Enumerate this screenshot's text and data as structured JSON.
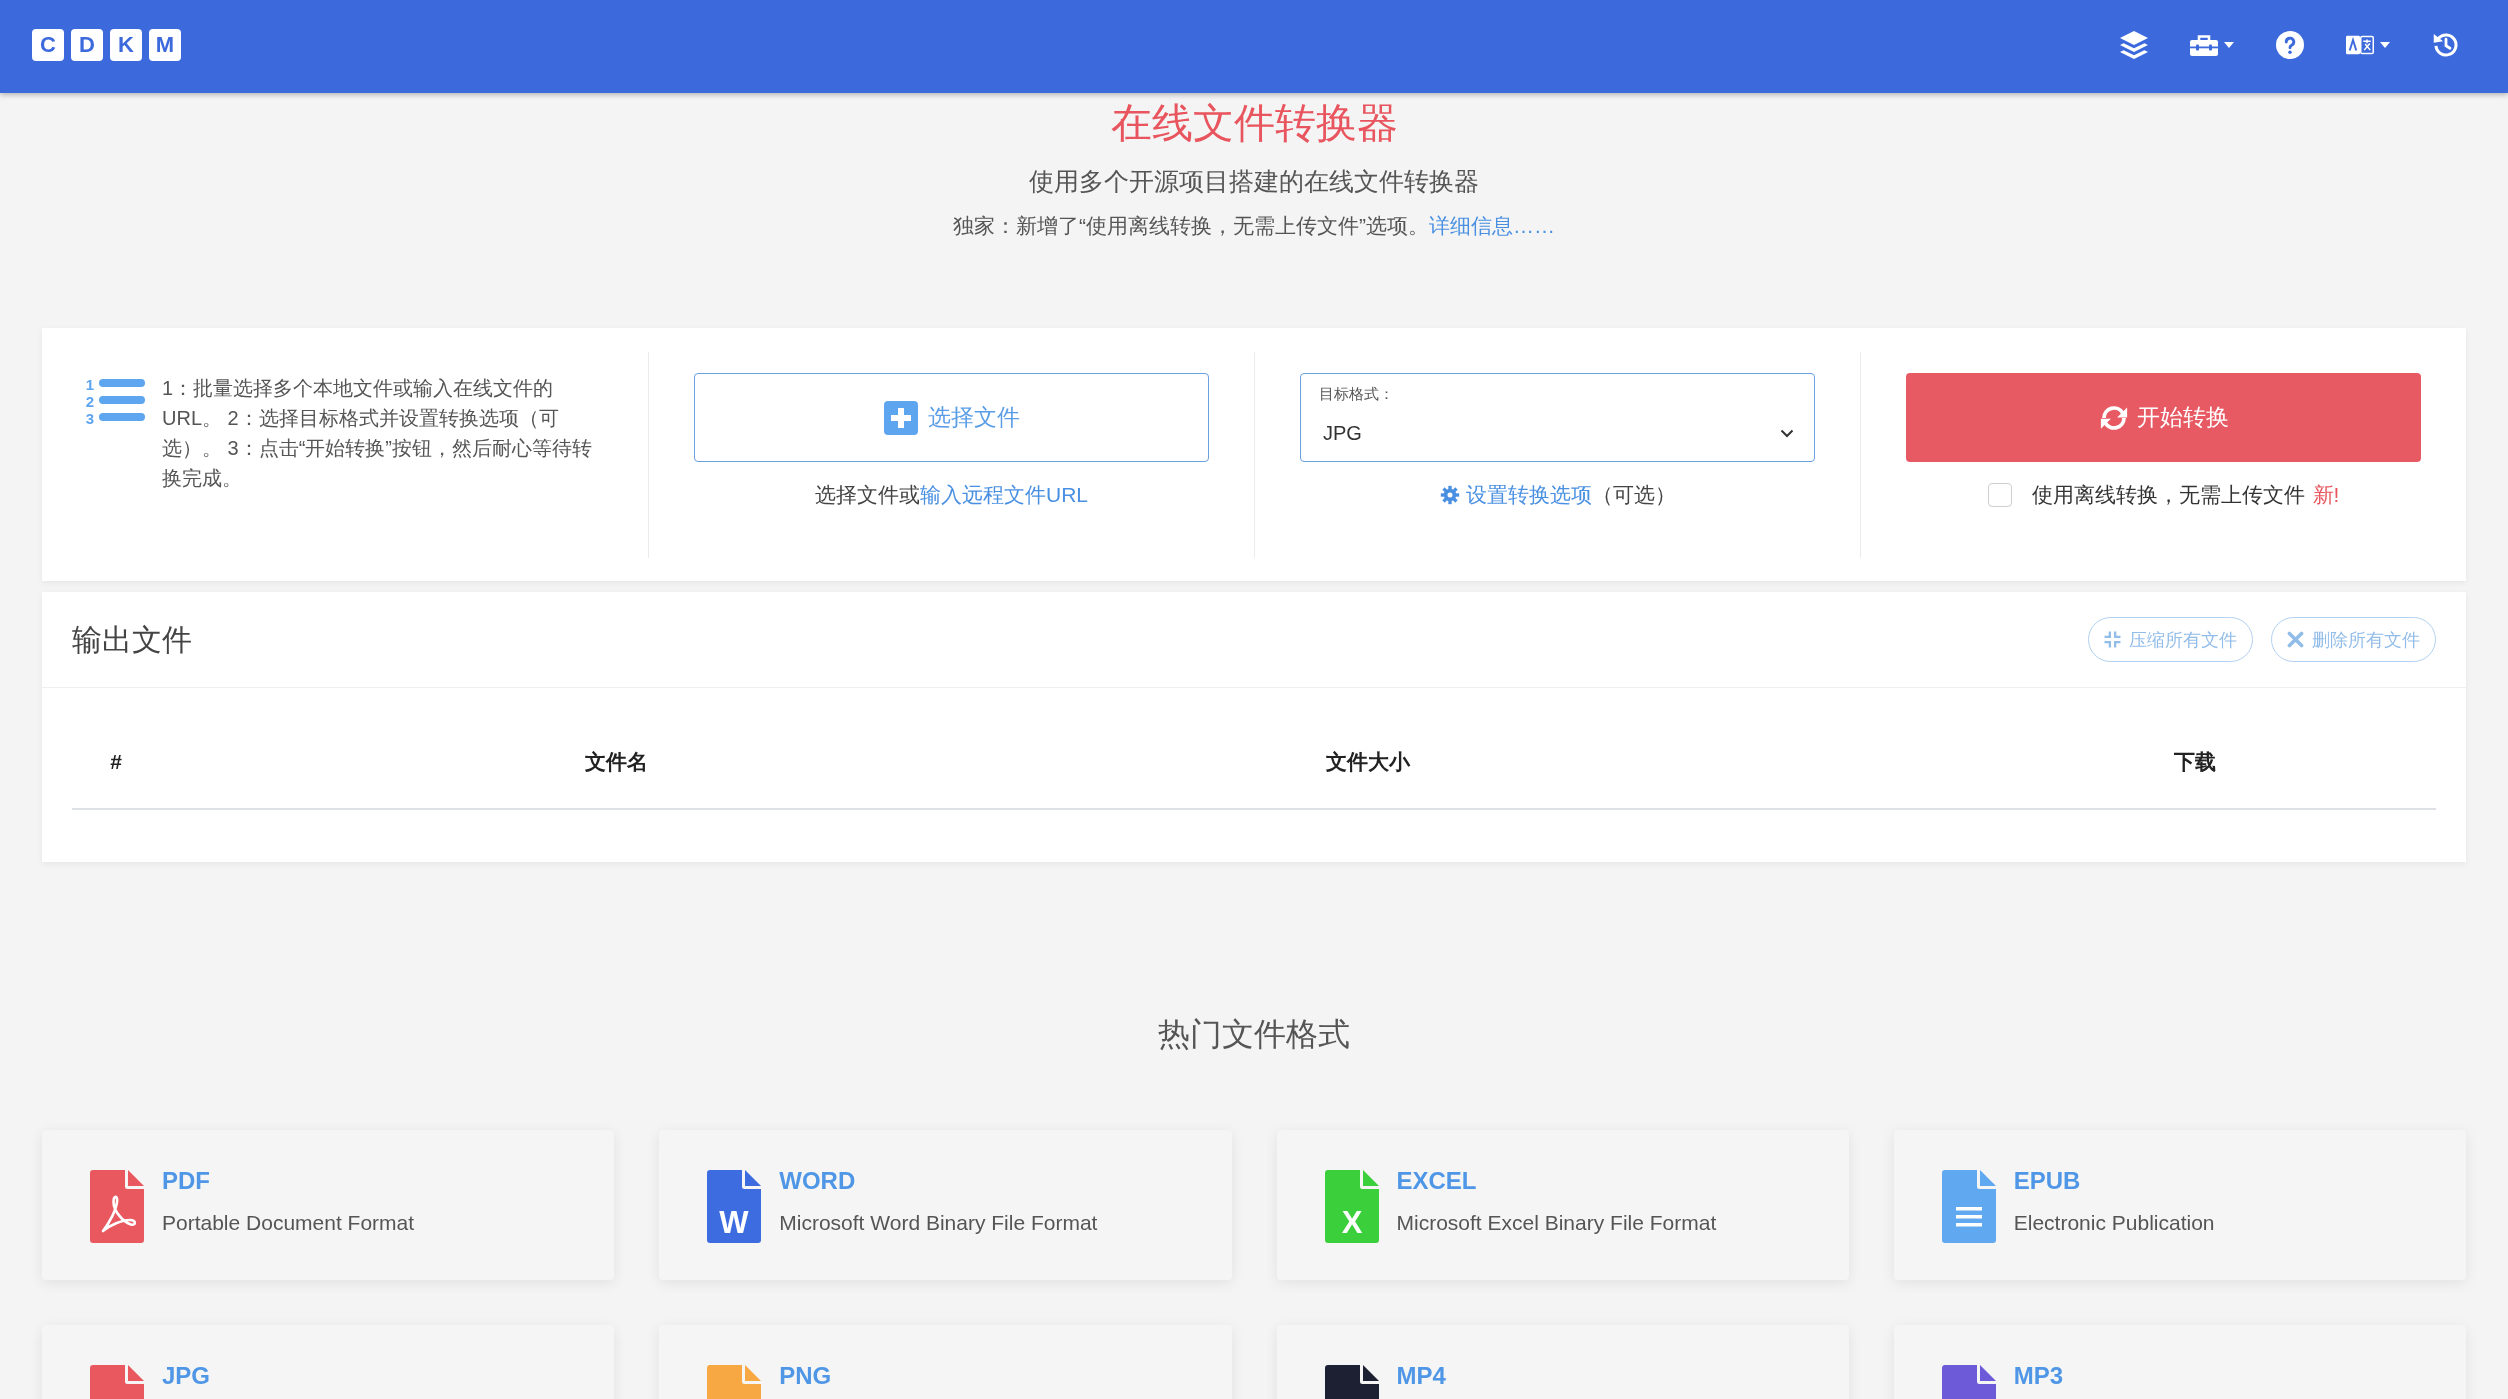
{
  "header": {
    "logo": [
      "C",
      "D",
      "K",
      "M"
    ],
    "tools": [
      {
        "kind": "layers",
        "dropdown": false
      },
      {
        "kind": "toolbox",
        "dropdown": true
      },
      {
        "kind": "help",
        "dropdown": false
      },
      {
        "kind": "translate",
        "dropdown": true
      },
      {
        "kind": "history",
        "dropdown": false
      }
    ]
  },
  "hero": {
    "title": "在线文件转换器",
    "subtitle": "使用多个开源项目搭建的在线文件转换器",
    "notice": {
      "text": "独家：新增了“使用离线转换，无需上传文件”选项。",
      "link": "详细信息……"
    }
  },
  "converter": {
    "steps": {
      "icon_numbers": [
        "1",
        "2",
        "3"
      ],
      "text": "1：批量选择多个本地文件或输入在线文件的URL。 2：选择目标格式并设置转换选项（可选）。 3：点击“开始转换”按钮，然后耐心等待转换完成。"
    },
    "file_button": {
      "label": "选择文件"
    },
    "file_hint": {
      "text": "选择文件或",
      "link": "输入远程文件URL"
    },
    "format_select": {
      "label": "目标格式：",
      "value": "JPG"
    },
    "options_hint": {
      "link": "设置转换选项",
      "suffix": "（可选）"
    },
    "start_button": {
      "label": "开始转换"
    },
    "offline_option": {
      "label": "使用离线转换，无需上传文件",
      "badge": "新!",
      "checked": false
    }
  },
  "output": {
    "title": "输出文件",
    "actions": [
      {
        "kind": "compress",
        "label": "压缩所有文件",
        "disabled": true
      },
      {
        "kind": "delete",
        "label": "删除所有文件",
        "disabled": true
      }
    ],
    "table": {
      "columns": [
        "#",
        "文件名",
        "文件大小",
        "下载"
      ]
    }
  },
  "popular": {
    "title": "热门文件格式",
    "formats": [
      {
        "kind": "pdf",
        "name": "PDF",
        "description": "Portable Document Format",
        "color": "#e9585f"
      },
      {
        "kind": "word",
        "name": "WORD",
        "description": "Microsoft Word Binary File Format",
        "color": "#3d6ce0",
        "icon_text": "W"
      },
      {
        "kind": "excel",
        "name": "EXCEL",
        "description": "Microsoft Excel Binary File Format",
        "color": "#3bcf3b",
        "icon_text": "X"
      },
      {
        "kind": "epub",
        "name": "EPUB",
        "description": "Electronic Publication",
        "color": "#60a8f0"
      },
      {
        "kind": "generic",
        "name": "JPG",
        "color": "#e9585f"
      },
      {
        "kind": "generic",
        "name": "PNG",
        "color": "#f7a843"
      },
      {
        "kind": "generic",
        "name": "MP4",
        "color": "#1d2033"
      },
      {
        "kind": "generic",
        "name": "MP3",
        "color": "#6c5ad9"
      }
    ]
  }
}
